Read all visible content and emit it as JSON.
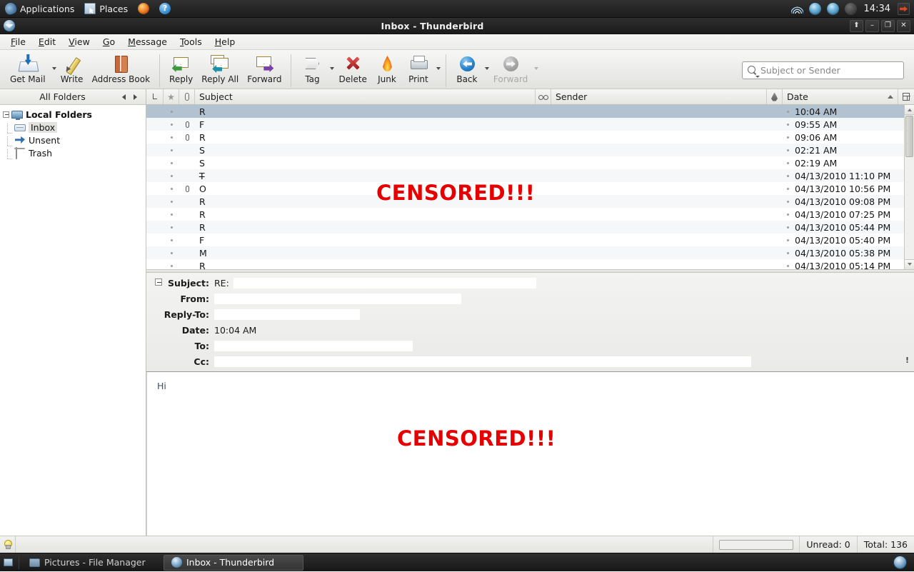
{
  "desktop": {
    "panel": {
      "applications_label": "Applications",
      "places_label": "Places",
      "clock": "14:34",
      "icons": [
        "foot-icon",
        "places-icon",
        "firefox-icon",
        "help-icon"
      ],
      "tray_icons": [
        "wifi-icon",
        "network-icon",
        "network-icon",
        "volume-icon",
        "logout-icon"
      ]
    },
    "taskbar": {
      "tasks": [
        {
          "label": "Pictures - File Manager",
          "icon": "folder-icon",
          "active": false
        },
        {
          "label": "Inbox - Thunderbird",
          "icon": "thunderbird-icon",
          "active": true
        }
      ]
    }
  },
  "window": {
    "title": "Inbox - Thunderbird",
    "buttons": [
      {
        "name": "shade-button",
        "glyph": "⬆"
      },
      {
        "name": "minimize-button",
        "glyph": "–"
      },
      {
        "name": "maximize-button",
        "glyph": "❐"
      },
      {
        "name": "close-button",
        "glyph": "✕"
      }
    ]
  },
  "menubar": {
    "items": [
      {
        "label": "File",
        "accel": "F"
      },
      {
        "label": "Edit",
        "accel": "E"
      },
      {
        "label": "View",
        "accel": "V"
      },
      {
        "label": "Go",
        "accel": "G"
      },
      {
        "label": "Message",
        "accel": "M"
      },
      {
        "label": "Tools",
        "accel": "T"
      },
      {
        "label": "Help",
        "accel": "H"
      }
    ]
  },
  "toolbar": {
    "buttons": [
      {
        "label": "Get Mail",
        "icon": "get-mail-icon",
        "dropdown": true,
        "disabled": false
      },
      {
        "label": "Write",
        "icon": "write-icon",
        "dropdown": false,
        "disabled": false
      },
      {
        "label": "Address Book",
        "icon": "address-book-icon",
        "dropdown": false,
        "disabled": false
      },
      {
        "label": "Reply",
        "icon": "reply-icon",
        "dropdown": false,
        "disabled": false
      },
      {
        "label": "Reply All",
        "icon": "reply-all-icon",
        "dropdown": false,
        "disabled": false
      },
      {
        "label": "Forward",
        "icon": "forward-icon",
        "dropdown": false,
        "disabled": false
      },
      {
        "label": "Tag",
        "icon": "tag-icon",
        "dropdown": true,
        "disabled": false
      },
      {
        "label": "Delete",
        "icon": "delete-icon",
        "dropdown": false,
        "disabled": false
      },
      {
        "label": "Junk",
        "icon": "junk-icon",
        "dropdown": false,
        "disabled": false
      },
      {
        "label": "Print",
        "icon": "print-icon",
        "dropdown": true,
        "disabled": false
      },
      {
        "label": "Back",
        "icon": "back-icon",
        "dropdown": true,
        "disabled": false
      },
      {
        "label": "Forward",
        "icon": "nav-forward-icon",
        "dropdown": true,
        "disabled": true
      }
    ]
  },
  "search": {
    "placeholder": "Subject or Sender",
    "value": "",
    "icon": "search-icon"
  },
  "folder_pane": {
    "header": "All Folders",
    "nav_back_icon": "arrow-left-icon",
    "nav_forward_icon": "arrow-right-icon",
    "tree": [
      {
        "label": "Local Folders",
        "icon": "server-icon",
        "level": 0,
        "expanded": true,
        "selected": false
      },
      {
        "label": "Inbox",
        "icon": "inbox-icon",
        "level": 1,
        "selected": true
      },
      {
        "label": "Unsent",
        "icon": "unsent-icon",
        "level": 1,
        "selected": false
      },
      {
        "label": "Trash",
        "icon": "trash-icon",
        "level": 1,
        "selected": false
      }
    ]
  },
  "message_list": {
    "columns": [
      {
        "name": "thread-column",
        "label": "",
        "icon": "thread-icon"
      },
      {
        "name": "star-column",
        "label": "",
        "icon": "star-icon"
      },
      {
        "name": "attachment-column",
        "label": "",
        "icon": "paperclip-icon"
      },
      {
        "name": "subject-column",
        "label": "Subject",
        "icon": ""
      },
      {
        "name": "read-column",
        "label": "",
        "icon": "glasses-icon"
      },
      {
        "name": "sender-column",
        "label": "Sender",
        "icon": ""
      },
      {
        "name": "junk-column",
        "label": "",
        "icon": "flame-icon"
      },
      {
        "name": "date-column",
        "label": "Date",
        "icon": "",
        "sort": "ascending"
      },
      {
        "name": "column-picker",
        "label": "",
        "icon": "column-picker-icon"
      }
    ],
    "rows": [
      {
        "subject": "R",
        "date": "10:04 AM",
        "attachment": false,
        "selected": true
      },
      {
        "subject": "F",
        "date": "09:55 AM",
        "attachment": true,
        "selected": false
      },
      {
        "subject": "R",
        "date": "09:06 AM",
        "attachment": true,
        "selected": false
      },
      {
        "subject": "S",
        "date": "02:21 AM",
        "attachment": false,
        "selected": false
      },
      {
        "subject": "S",
        "date": "02:19 AM",
        "attachment": false,
        "selected": false
      },
      {
        "subject": "T̶",
        "date": "04/13/2010 11:10 PM",
        "attachment": false,
        "selected": false
      },
      {
        "subject": "O",
        "date": "04/13/2010 10:56 PM",
        "attachment": true,
        "selected": false
      },
      {
        "subject": "R",
        "date": "04/13/2010 09:08 PM",
        "attachment": false,
        "selected": false
      },
      {
        "subject": "R",
        "date": "04/13/2010 07:25 PM",
        "attachment": false,
        "selected": false
      },
      {
        "subject": "R",
        "date": "04/13/2010 05:44 PM",
        "attachment": false,
        "selected": false
      },
      {
        "subject": "F",
        "date": "04/13/2010 05:40 PM",
        "attachment": false,
        "selected": false
      },
      {
        "subject": "M",
        "date": "04/13/2010 05:38 PM",
        "attachment": false,
        "selected": false
      },
      {
        "subject": "R",
        "date": "04/13/2010 05:14 PM",
        "attachment": false,
        "selected": false
      }
    ],
    "censor_overlay": "CENSORED!!!"
  },
  "message_header": {
    "collapse_icon": "collapse-icon",
    "fields": [
      {
        "label": "Subject:",
        "value": "RE:",
        "redacted": true
      },
      {
        "label": "From:",
        "value": "",
        "redacted": true
      },
      {
        "label": "Reply-To:",
        "value": "",
        "redacted": true
      },
      {
        "label": "Date:",
        "value": "10:04 AM",
        "redacted": false
      },
      {
        "label": "To:",
        "value": "",
        "redacted": true
      },
      {
        "label": "Cc:",
        "value": "",
        "redacted": true
      }
    ],
    "attachment_marker": "!"
  },
  "message_body": {
    "greeting": "Hi",
    "censor_overlay": "CENSORED!!!"
  },
  "statusbar": {
    "bulb_icon": "lightbulb-icon",
    "status_text": "",
    "unread": "Unread: 0",
    "total": "Total: 136"
  },
  "colors": {
    "censor_red": "#e60000",
    "selection_blue": "#b3c2d1",
    "panel_dark": "#262626"
  }
}
